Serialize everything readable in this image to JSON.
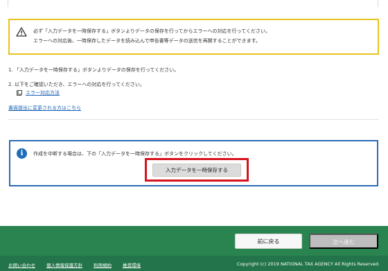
{
  "warning": {
    "line1": "必ず「入力データを一時保存する」ボタンよりデータの保存を行ってからエラーへの対応を行ってください。",
    "line2": "エラーへの対応後、一時保存したデータを読み込んで申告書等データの送信を再開することができます。"
  },
  "steps": {
    "step1": "1. 「入力データを一時保存する」ボタンよりデータの保存を行ってください。",
    "step2": "2. 以下をご確認いただき、エラーへの対応を行ってください。",
    "error_guide_link": "エラー対応方法",
    "paper_submission_link": "書面提出に変更される方はこちら"
  },
  "info": {
    "text": "作成を中断する場合は、下の「入力データを一時保存する」ボタンをクリックしてください。",
    "save_button": "入力データを一時保存する"
  },
  "footer_nav": {
    "back_button": "前に戻る",
    "next_button": "次へ進む"
  },
  "footer_links": [
    "お問い合わせ",
    "個人情報保護方針",
    "利用規約",
    "推奨環境"
  ],
  "copyright": "Copyright (c) 2019 NATIONAL TAX AGENCY All Rights Reserved.",
  "icons": {
    "warning": "warning-triangle-icon",
    "info": "info-icon",
    "book": "book-icon"
  },
  "colors": {
    "warning_border": "#e8c21c",
    "info_border": "#2a6ab4",
    "highlight": "#d7111d",
    "footer": "#2a8450",
    "link": "#1a62b5"
  }
}
